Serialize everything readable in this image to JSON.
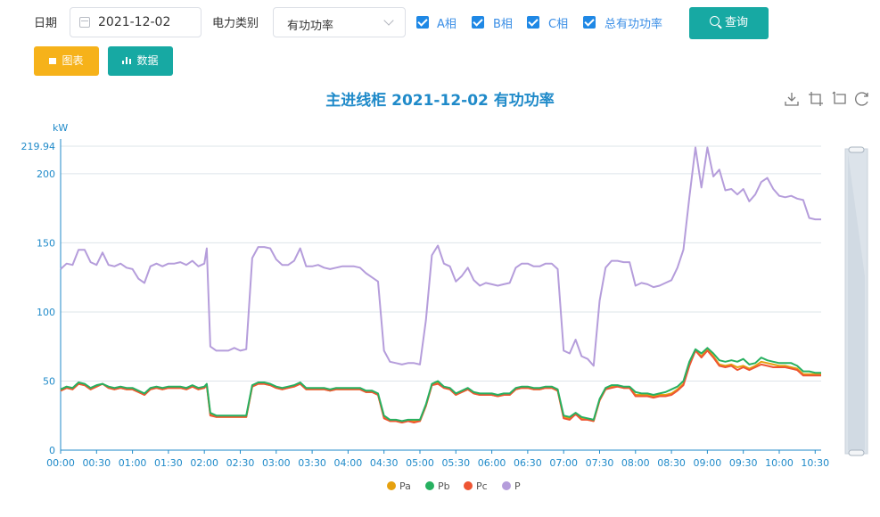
{
  "filters": {
    "date_label": "日期",
    "date_value": "2021-12-02",
    "category_label": "电力类别",
    "category_value": "有功功率",
    "checkboxes": [
      {
        "label": "A相",
        "checked": true
      },
      {
        "label": "B相",
        "checked": true
      },
      {
        "label": "C相",
        "checked": true
      },
      {
        "label": "总有功功率",
        "checked": true
      }
    ],
    "query_label": "查询",
    "chart_label": "图表",
    "data_label": "数据"
  },
  "toolbox_icons": [
    "download-icon",
    "zoom-icon",
    "zoom-reset-icon",
    "restore-icon"
  ],
  "colors": {
    "Pa": "#e6a10f",
    "Pb": "#27b060",
    "Pc": "#ee5533",
    "P": "#b59ddb",
    "axis": "#1f8ac9",
    "accent": "#17a9a3",
    "warn": "#f6b21a"
  },
  "chart_data": {
    "type": "line",
    "title": "主进线柜  2021-12-02  有功功率",
    "ylabel": "kW",
    "ylim": [
      0,
      219.94
    ],
    "y_ticks": [
      "219.94",
      "200",
      "150",
      "100",
      "50",
      "0"
    ],
    "x_tick_labels": [
      "00:00",
      "00:30",
      "01:00",
      "01:30",
      "02:00",
      "02:30",
      "03:00",
      "03:30",
      "04:00",
      "04:30",
      "05:00",
      "05:30",
      "06:00",
      "06:30",
      "07:00",
      "07:30",
      "08:00",
      "08:30",
      "09:00",
      "09:30",
      "10:00",
      "10:30"
    ],
    "grid": true,
    "legend_position": "bottom",
    "x_minutes": [
      0,
      5,
      10,
      15,
      20,
      25,
      30,
      35,
      40,
      45,
      50,
      55,
      60,
      65,
      70,
      75,
      80,
      85,
      90,
      95,
      100,
      105,
      110,
      115,
      120,
      122,
      125,
      130,
      135,
      140,
      145,
      150,
      155,
      160,
      165,
      170,
      175,
      180,
      185,
      190,
      195,
      200,
      205,
      210,
      215,
      220,
      225,
      230,
      235,
      240,
      245,
      250,
      255,
      260,
      265,
      270,
      275,
      280,
      285,
      290,
      295,
      300,
      305,
      310,
      315,
      320,
      325,
      330,
      335,
      340,
      345,
      350,
      355,
      360,
      365,
      370,
      375,
      380,
      385,
      390,
      395,
      400,
      405,
      410,
      415,
      420,
      425,
      430,
      435,
      440,
      445,
      450,
      455,
      460,
      465,
      470,
      475,
      480,
      485,
      490,
      495,
      500,
      505,
      510,
      515,
      520,
      525,
      530,
      535,
      540,
      545,
      550,
      555,
      560,
      565,
      570,
      575,
      580,
      585,
      590,
      595,
      600,
      605,
      610,
      615,
      620,
      625,
      630,
      635
    ],
    "series": [
      {
        "name": "Pa",
        "values": [
          43,
          45,
          44,
          48,
          47,
          44,
          46,
          48,
          45,
          44,
          45,
          44,
          44,
          42,
          40,
          44,
          45,
          44,
          45,
          45,
          45,
          44,
          46,
          44,
          45,
          47,
          26,
          24,
          24,
          24,
          24,
          24,
          24,
          46,
          48,
          48,
          47,
          45,
          44,
          45,
          46,
          48,
          44,
          44,
          44,
          44,
          43,
          44,
          44,
          44,
          44,
          44,
          42,
          42,
          40,
          24,
          21,
          21,
          20,
          21,
          21,
          21,
          32,
          47,
          49,
          45,
          44,
          40,
          42,
          44,
          41,
          40,
          40,
          40,
          39,
          40,
          40,
          44,
          45,
          45,
          44,
          44,
          45,
          45,
          43,
          24,
          23,
          26,
          23,
          22,
          21,
          36,
          44,
          46,
          46,
          45,
          45,
          40,
          40,
          40,
          39,
          40,
          40,
          41,
          44,
          48,
          62,
          72,
          68,
          73,
          68,
          62,
          61,
          62,
          60,
          61,
          59,
          61,
          64,
          63,
          62,
          61,
          61,
          60,
          59,
          55,
          55,
          55,
          55,
          56,
          54,
          55,
          54
        ]
      },
      {
        "name": "Pb",
        "values": [
          44,
          46,
          45,
          49,
          48,
          45,
          47,
          48,
          46,
          45,
          46,
          45,
          45,
          43,
          41,
          45,
          46,
          45,
          46,
          46,
          46,
          45,
          47,
          45,
          46,
          48,
          27,
          25,
          25,
          25,
          25,
          25,
          25,
          47,
          49,
          49,
          48,
          46,
          45,
          46,
          47,
          49,
          45,
          45,
          45,
          45,
          44,
          45,
          45,
          45,
          45,
          45,
          43,
          43,
          41,
          25,
          22,
          22,
          21,
          22,
          22,
          22,
          33,
          48,
          50,
          46,
          45,
          41,
          43,
          45,
          42,
          41,
          41,
          41,
          40,
          41,
          41,
          45,
          46,
          46,
          45,
          45,
          46,
          46,
          44,
          25,
          24,
          27,
          24,
          23,
          22,
          37,
          45,
          47,
          47,
          46,
          46,
          42,
          41,
          41,
          40,
          41,
          42,
          44,
          46,
          50,
          64,
          73,
          70,
          74,
          70,
          65,
          64,
          65,
          64,
          66,
          62,
          63,
          67,
          65,
          64,
          63,
          63,
          63,
          61,
          57,
          57,
          56,
          56,
          57,
          56,
          57,
          55
        ]
      },
      {
        "name": "Pc",
        "values": [
          43,
          45,
          44,
          48,
          47,
          44,
          46,
          48,
          45,
          44,
          45,
          44,
          44,
          42,
          40,
          44,
          45,
          44,
          45,
          45,
          45,
          44,
          46,
          44,
          45,
          47,
          25,
          24,
          24,
          24,
          24,
          24,
          24,
          46,
          48,
          48,
          47,
          45,
          44,
          45,
          46,
          48,
          44,
          44,
          44,
          44,
          43,
          44,
          44,
          44,
          44,
          44,
          42,
          42,
          40,
          23,
          21,
          21,
          20,
          21,
          20,
          21,
          32,
          47,
          48,
          45,
          44,
          40,
          42,
          44,
          41,
          40,
          40,
          40,
          39,
          40,
          40,
          44,
          45,
          45,
          44,
          44,
          45,
          45,
          43,
          23,
          22,
          26,
          22,
          22,
          21,
          36,
          44,
          45,
          46,
          45,
          45,
          39,
          39,
          39,
          38,
          39,
          39,
          40,
          43,
          47,
          61,
          72,
          67,
          72,
          67,
          61,
          60,
          61,
          58,
          60,
          58,
          60,
          62,
          61,
          60,
          60,
          60,
          59,
          58,
          54,
          54,
          54,
          54,
          55,
          53,
          55,
          53
        ]
      },
      {
        "name": "P",
        "values": [
          131,
          135,
          134,
          145,
          145,
          136,
          134,
          143,
          134,
          133,
          135,
          132,
          131,
          124,
          121,
          133,
          135,
          133,
          135,
          135,
          136,
          134,
          137,
          133,
          135,
          146,
          75,
          72,
          72,
          72,
          74,
          72,
          73,
          139,
          147,
          147,
          146,
          138,
          134,
          134,
          137,
          146,
          133,
          133,
          134,
          132,
          131,
          132,
          133,
          133,
          133,
          132,
          128,
          125,
          122,
          72,
          64,
          63,
          62,
          63,
          63,
          62,
          94,
          141,
          148,
          135,
          133,
          122,
          126,
          132,
          123,
          119,
          121,
          120,
          119,
          120,
          121,
          132,
          135,
          135,
          133,
          133,
          135,
          135,
          131,
          72,
          70,
          80,
          68,
          66,
          61,
          108,
          132,
          137,
          137,
          136,
          136,
          119,
          121,
          120,
          118,
          119,
          121,
          123,
          132,
          145,
          183,
          219,
          190,
          219,
          198,
          203,
          188,
          189,
          185,
          189,
          180,
          185,
          194,
          197,
          189,
          184,
          183,
          184,
          182,
          181,
          168,
          167,
          167,
          166,
          164,
          170,
          162
        ]
      }
    ]
  }
}
